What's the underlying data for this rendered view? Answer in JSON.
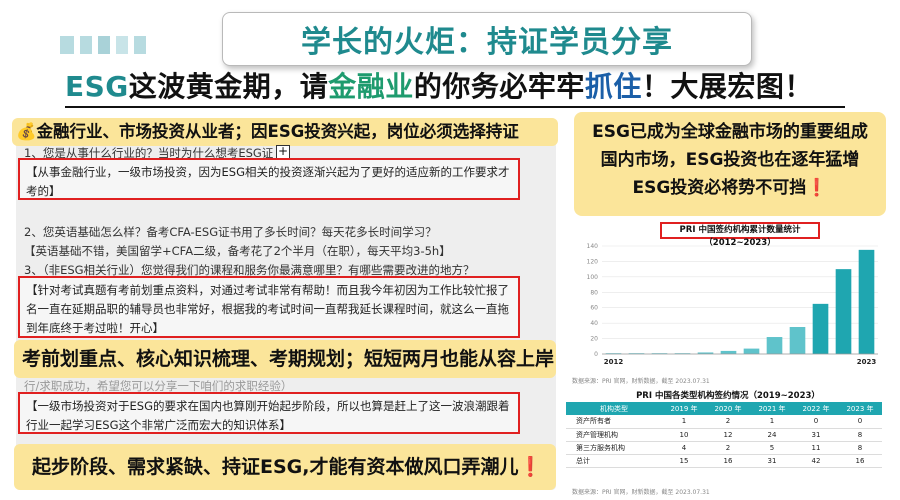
{
  "title": "学长的火炬：持证学员分享",
  "headline": {
    "part1": "ESG",
    "part2": "这波黄金期，请",
    "part3": "金融业",
    "part4": "的你务必牢牢",
    "part5": "抓住",
    "part6": "！大展宏图！"
  },
  "left": {
    "banner1": "💰金融行业、市场投资从业者；因ESG投资兴起，岗位必须选择持证",
    "q1": "1、您是从事什么行业的？当时为什么想考ESG证",
    "a1": "【从事金融行业，一级市场投资，因为ESG相关的投资逐渐兴起为了更好的适应新的工作要求才考的】",
    "q2": "2、您英语基础怎么样？备考CFA-ESG证书用了多长时间？每天花多长时间学习？",
    "a2": "【英语基础不错，美国留学+CFA二级，备考花了2个半月（在职），每天平均3-5h】",
    "q3": "3、（非ESG相关行业）您觉得我们的课程和服务你最满意哪里？有哪些需要改进的地方？",
    "a3": "【针对考试真题有考前划重点资料，对通过考试非常有帮助！而且我今年初因为工作比较忙报了名一直在延期品职的辅导员也非常好，根据我的考试时间一直帮我延长课程时间，就这么一直拖到年底终于考过啦！开心】",
    "banner2": "考前划重点、核心知识梳理、考期规划；短短两月也能从容上岸❗",
    "faint": "行/求职成功，希望您可以分享一下咱们的求职经验）",
    "a4": "【一级市场投资对于ESG的要求在国内也算刚开始起步阶段，所以也算是赶上了这一波浪潮跟着行业一起学习ESG这个非常广泛而宏大的知识体系】",
    "banner3": "起步阶段、需求紧缺、持证ESG,才能有资本做风口弄潮儿❗"
  },
  "right": {
    "info_line1": "ESG已成为全球金融市场的重要组成",
    "info_line2": "国内市场，ESG投资也在逐年猛增",
    "info_line3": "ESG投资必将势不可挡❗",
    "chart_title": "PRI 中国签约机构累计数量统计（2012~2023）",
    "chart_source": "数据来源：PRI 官网，财新数据，截至 2023.07.31",
    "table_title": "PRI 中国各类型机构签约情况（2019~2023）",
    "table_source": "数据来源：PRI 官网，财新数据，截至 2023.07.31",
    "table": {
      "headers": [
        "机构类型",
        "2019 年",
        "2020 年",
        "2021 年",
        "2022 年",
        "2023 年"
      ],
      "rows": [
        [
          "资产所有者",
          "1",
          "2",
          "1",
          "0",
          "0"
        ],
        [
          "资产管理机构",
          "10",
          "12",
          "24",
          "31",
          "8"
        ],
        [
          "第三方服务机构",
          "4",
          "2",
          "5",
          "11",
          "8"
        ],
        [
          "总计",
          "15",
          "16",
          "31",
          "42",
          "16"
        ]
      ]
    }
  },
  "chart_data": {
    "type": "bar",
    "title": "PRI 中国签约机构累计数量统计（2012~2023）",
    "x_tick_labels": [
      "2012",
      "2023"
    ],
    "y_ticks": [
      0,
      20,
      40,
      60,
      80,
      100,
      120,
      140
    ],
    "ylim": [
      0,
      140
    ],
    "grid": true,
    "values": [
      1,
      1,
      1,
      1,
      2,
      4,
      7,
      22,
      35,
      65,
      110,
      135
    ],
    "color": "#1fa6b0"
  }
}
